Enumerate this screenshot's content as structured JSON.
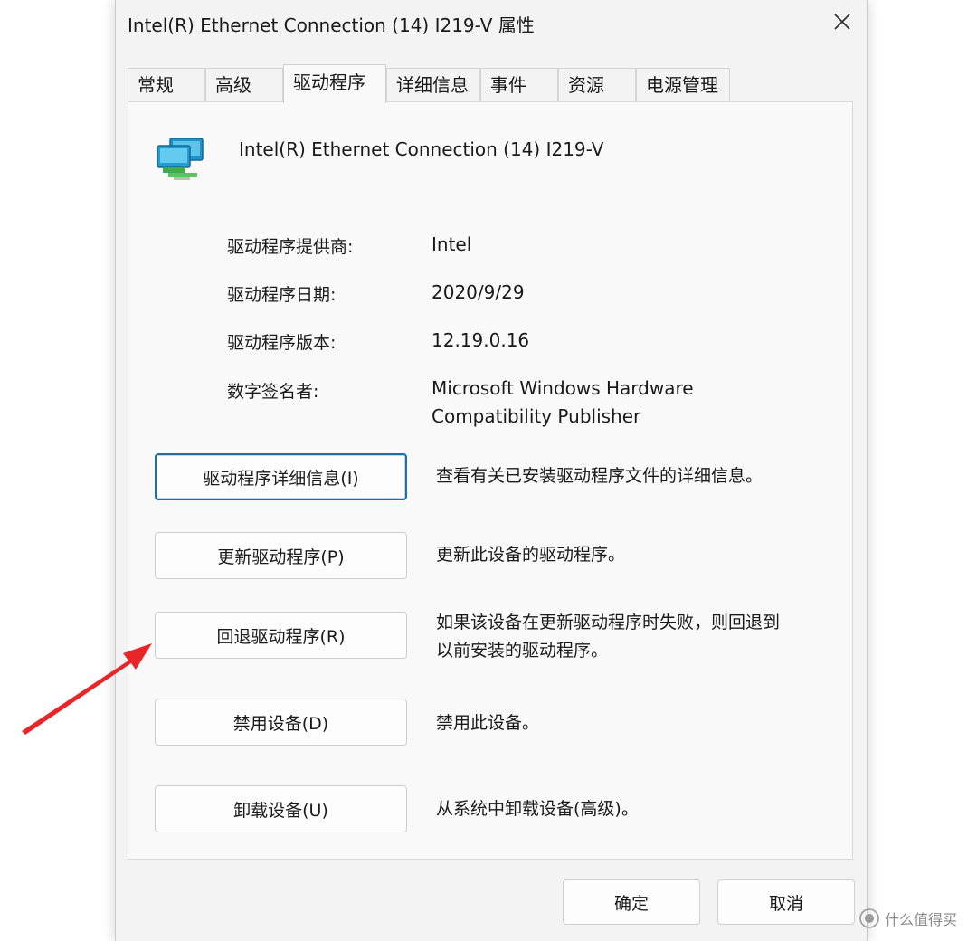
{
  "window": {
    "title": "Intel(R) Ethernet Connection (14) I219-V 属性"
  },
  "tabs": [
    {
      "label": "常规"
    },
    {
      "label": "高级"
    },
    {
      "label": "驱动程序"
    },
    {
      "label": "详细信息"
    },
    {
      "label": "事件"
    },
    {
      "label": "资源"
    },
    {
      "label": "电源管理"
    }
  ],
  "active_tab": "驱动程序",
  "device": {
    "name": "Intel(R) Ethernet Connection (14) I219-V",
    "icon": "network-adapter-icon"
  },
  "driver_info": {
    "provider_label": "驱动程序提供商:",
    "provider_value": "Intel",
    "date_label": "驱动程序日期:",
    "date_value": "2020/9/29",
    "version_label": "驱动程序版本:",
    "version_value": "12.19.0.16",
    "signer_label": "数字签名者:",
    "signer_value_line1": "Microsoft Windows Hardware",
    "signer_value_line2": "Compatibility Publisher"
  },
  "actions": [
    {
      "label": "驱动程序详细信息(I)",
      "desc_line1": "查看有关已安装驱动程序文件的详细信息。",
      "desc_line2": ""
    },
    {
      "label": "更新驱动程序(P)",
      "desc_line1": "更新此设备的驱动程序。",
      "desc_line2": ""
    },
    {
      "label": "回退驱动程序(R)",
      "desc_line1": "如果该设备在更新驱动程序时失败，则回退到",
      "desc_line2": "以前安装的驱动程序。"
    },
    {
      "label": "禁用设备(D)",
      "desc_line1": "禁用此设备。",
      "desc_line2": ""
    },
    {
      "label": "卸载设备(U)",
      "desc_line1": "从系统中卸载设备(高级)。",
      "desc_line2": ""
    }
  ],
  "footer": {
    "ok_label": "确定",
    "cancel_label": "取消"
  },
  "watermark": {
    "text": "什么值得买",
    "icon": "smzdm-logo-icon"
  },
  "colors": {
    "focus_border": "#1d6fa5",
    "annotation_arrow": "#e8262a"
  }
}
